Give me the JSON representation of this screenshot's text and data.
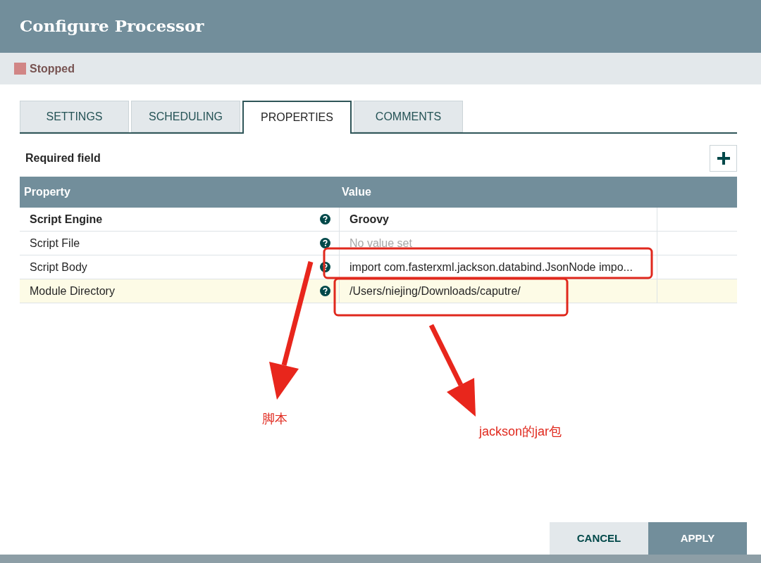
{
  "window": {
    "title": "Configure Processor"
  },
  "status": {
    "label": "Stopped"
  },
  "tabs": [
    {
      "label": "SETTINGS",
      "selected": false
    },
    {
      "label": "SCHEDULING",
      "selected": false
    },
    {
      "label": "PROPERTIES",
      "selected": true
    },
    {
      "label": "COMMENTS",
      "selected": false
    }
  ],
  "required_note": "Required field",
  "table": {
    "columns": [
      "Property",
      "Value"
    ],
    "rows": [
      {
        "name": "Script Engine",
        "required": true,
        "value": "Groovy",
        "value_set": true,
        "selected": false
      },
      {
        "name": "Script File",
        "required": false,
        "value": "No value set",
        "value_set": false,
        "selected": false
      },
      {
        "name": "Script Body",
        "required": false,
        "value": "import com.fasterxml.jackson.databind.JsonNode impo...",
        "value_set": true,
        "selected": false
      },
      {
        "name": "Module Directory",
        "required": false,
        "value": "/Users/niejing/Downloads/caputre/",
        "value_set": true,
        "selected": true
      }
    ]
  },
  "annotations": [
    {
      "text": "脚本"
    },
    {
      "text": "jackson的jar包"
    }
  ],
  "buttons": [
    {
      "label": "CANCEL",
      "kind": "secondary"
    },
    {
      "label": "APPLY",
      "kind": "primary"
    }
  ]
}
